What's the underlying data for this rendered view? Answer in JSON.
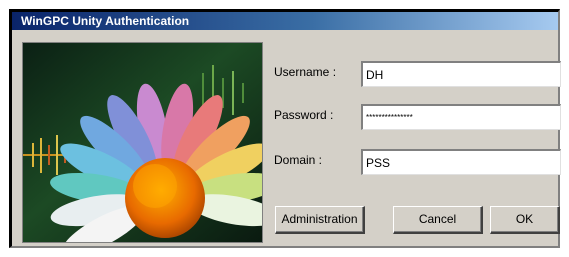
{
  "window": {
    "title": "WinGPC Unity Authentication"
  },
  "form": {
    "username_label": "Username :",
    "username_value": "DH",
    "password_label": "Password :",
    "password_value": "***************",
    "domain_label": "Domain :",
    "domain_value": "PSS"
  },
  "buttons": {
    "administration": "Administration",
    "cancel": "Cancel",
    "ok": "OK"
  }
}
